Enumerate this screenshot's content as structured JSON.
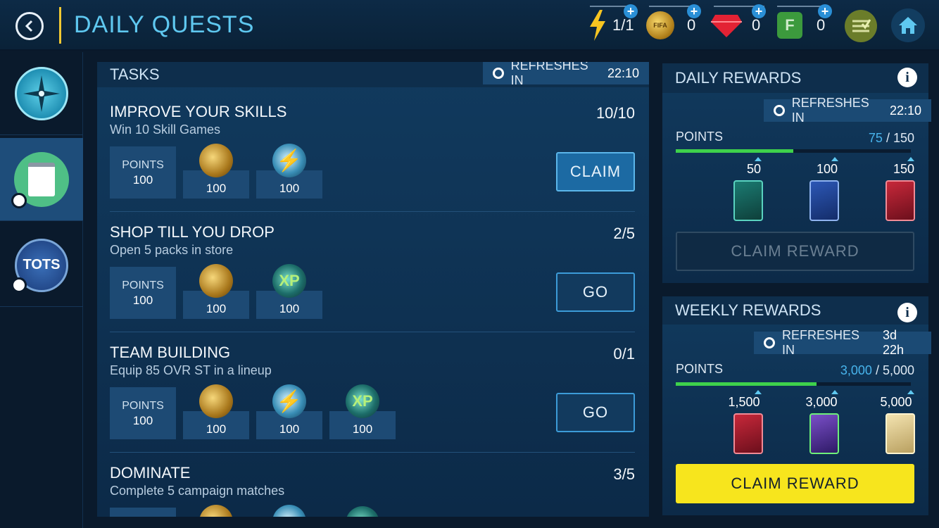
{
  "header": {
    "title": "DAILY QUESTS",
    "energy": "1/1",
    "coins": "0",
    "gems": "0",
    "fifa_points": "0"
  },
  "tasks_panel": {
    "title": "TASKS",
    "refresh_label": "REFRESHES IN",
    "refresh_time": "22:10",
    "tasks": [
      {
        "title": "IMPROVE YOUR SKILLS",
        "subtitle": "Win 10 Skill Games",
        "progress": "10/10",
        "points_label": "POINTS",
        "points": "100",
        "rewards": [
          {
            "icon": "coins-icon",
            "value": "100"
          },
          {
            "icon": "energy-bolt-icon",
            "value": "100"
          }
        ],
        "action": "CLAIM"
      },
      {
        "title": "SHOP TILL YOU DROP",
        "subtitle": "Open 5 packs in store",
        "progress": "2/5",
        "points_label": "POINTS",
        "points": "100",
        "rewards": [
          {
            "icon": "coins-icon",
            "value": "100"
          },
          {
            "icon": "xp-icon",
            "value": "100"
          }
        ],
        "action": "GO"
      },
      {
        "title": "TEAM BUILDING",
        "subtitle": "Equip 85 OVR ST in a lineup",
        "progress": "0/1",
        "points_label": "POINTS",
        "points": "100",
        "rewards": [
          {
            "icon": "coins-icon",
            "value": "100"
          },
          {
            "icon": "energy-bolt-icon",
            "value": "100"
          },
          {
            "icon": "xp-icon",
            "value": "100"
          }
        ],
        "action": "GO"
      },
      {
        "title": "DOMINATE",
        "subtitle": "Complete 5 campaign matches",
        "progress": "3/5"
      }
    ]
  },
  "daily_rewards": {
    "title": "DAILY REWARDS",
    "refresh_label": "REFRESHES IN",
    "refresh_time": "22:10",
    "points_label": "POINTS",
    "points_current": "75",
    "points_total": "/ 150",
    "progress_fraction": 0.5,
    "milestones": [
      "50",
      "100",
      "150"
    ],
    "claim_label": "CLAIM REWARD"
  },
  "weekly_rewards": {
    "title": "WEEKLY REWARDS",
    "refresh_label": "REFRESHES IN",
    "refresh_time": "3d 22h",
    "points_label": "POINTS",
    "points_current": "3,000",
    "points_total": "/ 5,000",
    "progress_fraction": 0.6,
    "milestones": [
      "1,500",
      "3,000",
      "5,000"
    ],
    "claim_label": "CLAIM REWARD"
  },
  "colors": {
    "accent": "#5fc8f0",
    "claim_yellow": "#f7e51d",
    "progress_green": "#3ed14b"
  }
}
